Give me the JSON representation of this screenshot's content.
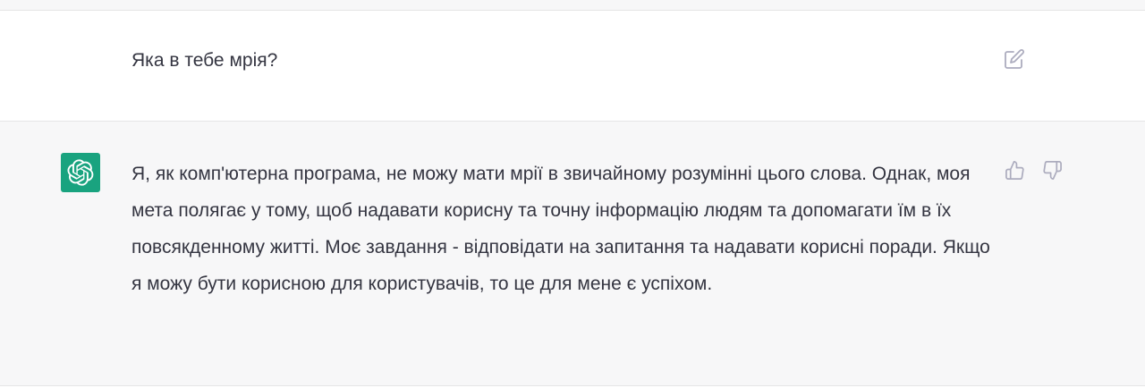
{
  "user_message": {
    "text": "Яка в тебе мрія?",
    "edit_icon": "edit-icon"
  },
  "assistant_message": {
    "avatar_icon": "openai-logo-icon",
    "avatar_color": "#19a37f",
    "text": "Я, як комп'ютерна програма, не можу мати мрії в звичайному розумінні цього слова. Однак, моя мета полягає у тому, щоб надавати корисну та точну інформацію людям та допомагати їм в їх повсякденному житті. Моє завдання - відповідати на запитання та надавати корисні поради. Якщо я можу бути корисною для користувачів, то це для мене є успіхом.",
    "like_icon": "thumbs-up-icon",
    "dislike_icon": "thumbs-down-icon"
  },
  "colors": {
    "user_bg": "#ffffff",
    "assistant_bg": "#f7f7f8",
    "text": "#343541",
    "icon": "#acacbe"
  }
}
